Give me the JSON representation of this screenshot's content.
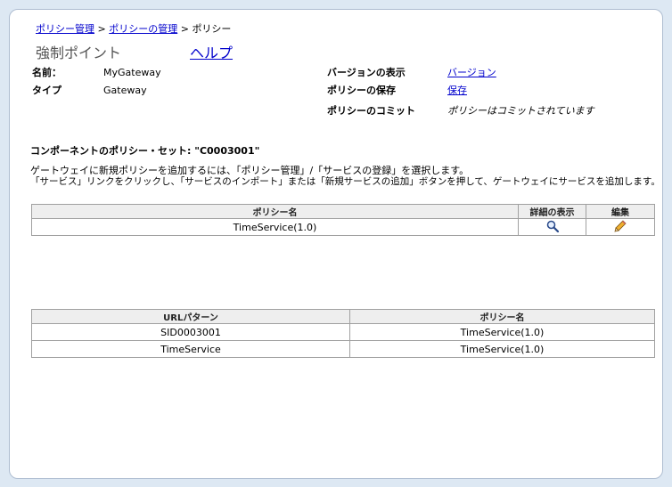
{
  "breadcrumb": {
    "items": [
      {
        "label": "ポリシー管理"
      },
      {
        "label": "ポリシーの管理"
      }
    ],
    "separator": ">",
    "current": "ポリシー"
  },
  "page": {
    "title": "強制ポイント",
    "help_link": "ヘルプ"
  },
  "info": {
    "name_label": "名前：",
    "name_value": "MyGateway",
    "type_label": "タイプ",
    "type_value": "Gateway",
    "version_label": "バージョンの表示",
    "version_link": "バージョン",
    "save_label": "ポリシーの保存",
    "save_link": "保存",
    "commit_label": "ポリシーのコミット",
    "commit_value": "ポリシーはコミットされています"
  },
  "component": {
    "heading": "コンポーネントのポリシー・セット: \"C0003001\"",
    "desc_line1": "ゲートウェイに新規ポリシーを追加するには、「ポリシー管理」/「サービスの登録」を選択します。",
    "desc_line2": "「サービス」リンクをクリックし、「サービスのインポート」または「新規サービスの追加」ボタンを押して、ゲートウェイにサービスを追加します。"
  },
  "policy_table": {
    "columns": [
      "ポリシー名",
      "詳細の表示",
      "編集"
    ],
    "rows": [
      {
        "policy_name": "TimeService(1.0)",
        "view_icon": "magnifier-icon",
        "edit_icon": "pencil-icon"
      }
    ]
  },
  "url_table": {
    "columns": [
      "URLパターン",
      "ポリシー名"
    ],
    "rows": [
      {
        "url": "SID0003001",
        "policy": "TimeService(1.0)"
      },
      {
        "url": "TimeService",
        "policy": "TimeService(1.0)"
      }
    ]
  },
  "colors": {
    "link": "#0000cc",
    "page_background": "#dde8f3",
    "table_header": "#eeeeee"
  }
}
